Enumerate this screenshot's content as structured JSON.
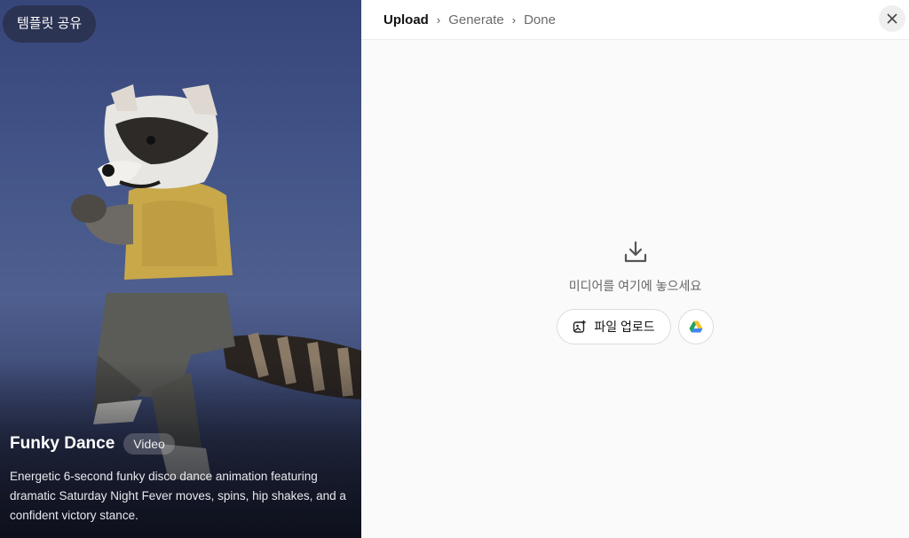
{
  "preview": {
    "share_label": "템플릿 공유",
    "title": "Funky Dance",
    "badge": "Video",
    "description": "Energetic 6-second funky disco dance animation featuring dramatic Saturday Night Fever moves, spins, hip shakes, and a confident victory stance."
  },
  "steps": [
    {
      "label": "Upload",
      "active": true
    },
    {
      "label": "Generate",
      "active": false
    },
    {
      "label": "Done",
      "active": false
    }
  ],
  "separator": "›",
  "dropzone": {
    "icon": "download-tray-icon",
    "text": "미디어를 여기에 놓으세요",
    "upload_label": "파일 업로드",
    "upload_icon": "image-plus-icon",
    "drive_icon": "google-drive-icon"
  },
  "close_icon": "close-icon",
  "colors": {
    "panel_bg": "#fafafa",
    "preview_bg": "#435488"
  }
}
